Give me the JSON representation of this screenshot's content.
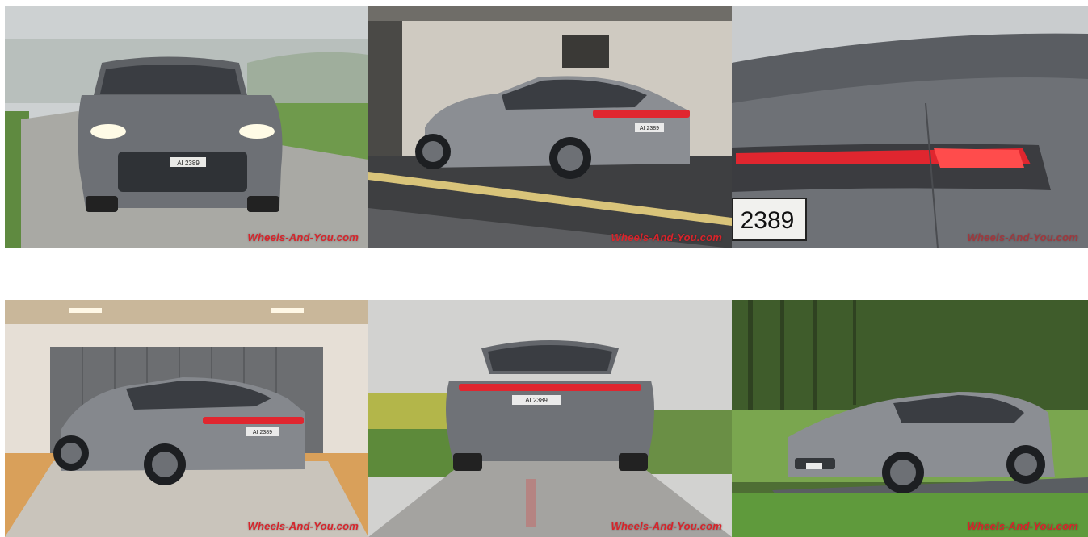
{
  "gallery": {
    "watermark": "Wheels-And-You.com",
    "photos": [
      {
        "plate": "AI 2389"
      },
      {
        "plate": "AI 2389"
      },
      {
        "plate": "2389"
      },
      {
        "plate": "AI 2389"
      },
      {
        "plate": "AI 2389"
      },
      {
        "plate": ""
      }
    ]
  },
  "colors": {
    "car_body": "#7d8085",
    "tail_light": "#e0262f",
    "watermark": "#d8242b",
    "grass": "#5d8a3a"
  }
}
